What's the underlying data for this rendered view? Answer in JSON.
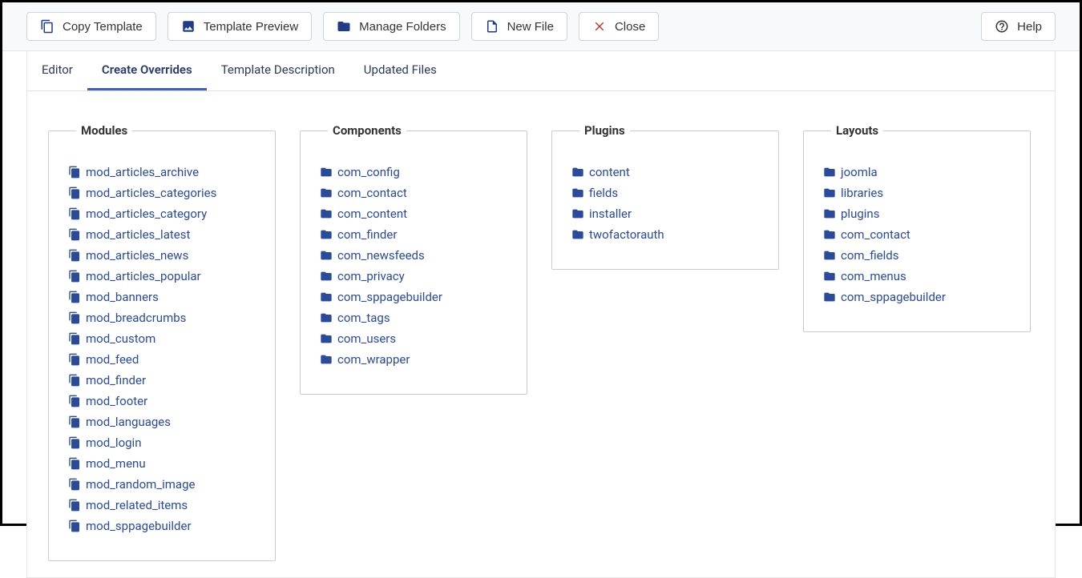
{
  "toolbar": {
    "copy_template": "Copy Template",
    "template_preview": "Template Preview",
    "manage_folders": "Manage Folders",
    "new_file": "New File",
    "close": "Close",
    "help": "Help"
  },
  "tabs": {
    "editor": "Editor",
    "create_overrides": "Create Overrides",
    "template_description": "Template Description",
    "updated_files": "Updated Files"
  },
  "groups": {
    "modules": {
      "title": "Modules",
      "items": [
        "mod_articles_archive",
        "mod_articles_categories",
        "mod_articles_category",
        "mod_articles_latest",
        "mod_articles_news",
        "mod_articles_popular",
        "mod_banners",
        "mod_breadcrumbs",
        "mod_custom",
        "mod_feed",
        "mod_finder",
        "mod_footer",
        "mod_languages",
        "mod_login",
        "mod_menu",
        "mod_random_image",
        "mod_related_items",
        "mod_sppagebuilder"
      ]
    },
    "components": {
      "title": "Components",
      "items": [
        "com_config",
        "com_contact",
        "com_content",
        "com_finder",
        "com_newsfeeds",
        "com_privacy",
        "com_sppagebuilder",
        "com_tags",
        "com_users",
        "com_wrapper"
      ]
    },
    "plugins": {
      "title": "Plugins",
      "items": [
        "content",
        "fields",
        "installer",
        "twofactorauth"
      ]
    },
    "layouts": {
      "title": "Layouts",
      "items": [
        "joomla",
        "libraries",
        "plugins",
        "com_contact",
        "com_fields",
        "com_menus",
        "com_sppagebuilder"
      ]
    }
  }
}
